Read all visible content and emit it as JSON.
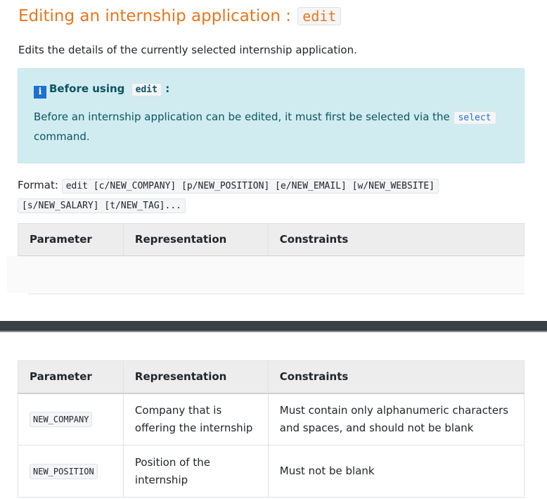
{
  "heading": {
    "text": "Editing an internship application : ",
    "code": "edit"
  },
  "description": "Edits the details of the currently selected internship application.",
  "callout": {
    "title_text": "Before using",
    "title_code": "edit",
    "title_suffix": ":",
    "body_text": "Before an internship application can be edited, it must first be selected via the",
    "body_code": "select",
    "body_suffix": "command."
  },
  "format": {
    "label": "Format:",
    "code_line1": "edit [c/NEW_COMPANY] [p/NEW_POSITION] [e/NEW_EMAIL] [w/NEW_WEBSITE]",
    "code_line2": "[s/NEW_SALARY] [t/NEW_TAG]..."
  },
  "table_headers": [
    "Parameter",
    "Representation",
    "Constraints"
  ],
  "table_rows": [
    {
      "parameter": "NEW_COMPANY",
      "representation_line1": "Company that is",
      "representation_line2": "offering the internship",
      "constraints_line1": "Must contain only alphanumeric characters",
      "constraints_line2": "and spaces, and should not be blank"
    },
    {
      "parameter": "NEW_POSITION",
      "representation_line1": "Position of the",
      "representation_line2": "internship",
      "constraints_line1": "Must not be blank",
      "constraints_line2": ""
    }
  ],
  "colors": {
    "heading": "#e8761e",
    "callout_bg": "#d1ecf1",
    "callout_text": "#0c5460",
    "link": "#1d6fd1"
  }
}
